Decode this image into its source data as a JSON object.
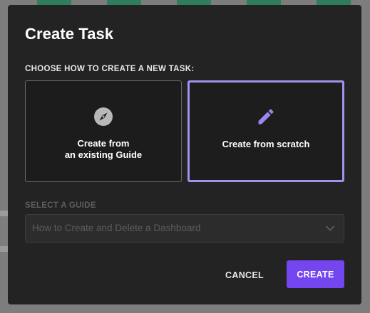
{
  "dialog": {
    "title": "Create Task",
    "section_label": "CHOOSE HOW TO CREATE A NEW TASK:",
    "options": [
      {
        "label_line1": "Create from",
        "label_line2": "an existing Guide",
        "icon": "compass-icon",
        "selected": false
      },
      {
        "label": "Create from scratch",
        "icon": "pencil-icon",
        "selected": true
      }
    ],
    "guide_select": {
      "label": "SELECT A GUIDE",
      "value": "How to Create and Delete a Dashboard",
      "disabled": true
    },
    "buttons": {
      "cancel": "CANCEL",
      "create": "CREATE"
    }
  },
  "colors": {
    "modal_bg": "#232323",
    "accent": "#7446f0",
    "selected_border": "#a690f0",
    "icon_purple": "#9d86ec",
    "icon_grey": "#b8b8b8"
  }
}
